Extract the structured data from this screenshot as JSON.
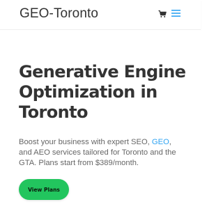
{
  "header": {
    "logo_text": "GEO-Toronto",
    "cart_icon": "cart-icon",
    "menu_icon": "hamburger-menu-icon",
    "accent_color": "#2ea3f2"
  },
  "hero": {
    "title_line1": "Generative Engine",
    "title_line2": "Optimization in",
    "title_line3": "Toronto",
    "desc_part1": "Boost your business with expert SEO, ",
    "desc_link": "GEO",
    "desc_part2": ", and AEO services tailored for Toronto and the GTA. Plans start from $389/month.",
    "cta_label": "View Plans",
    "cta_color": "#22c55e"
  }
}
